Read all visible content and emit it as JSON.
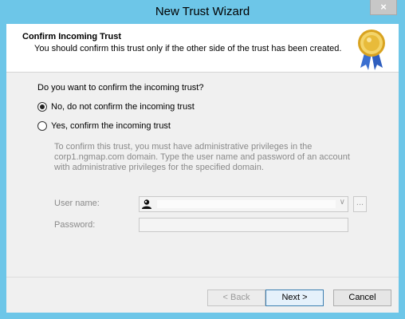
{
  "window": {
    "title": "New Trust Wizard",
    "close_label": "×"
  },
  "header": {
    "title": "Confirm Incoming Trust",
    "subtitle": "You should confirm this trust only if the other side of the trust has been created."
  },
  "question": "Do you want to confirm the incoming trust?",
  "options": [
    {
      "label": "No, do not confirm the incoming trust",
      "selected": true
    },
    {
      "label": "Yes, confirm the incoming trust",
      "selected": false
    }
  ],
  "info_text": "To confirm this trust, you must have administrative privileges in the corp1.ngmap.com domain. Type the user name and password of an account with administrative privileges for the specified domain.",
  "fields": {
    "username_label": "User name:",
    "password_label": "Password:",
    "browse_label": "..."
  },
  "buttons": {
    "back": "< Back",
    "next": "Next >",
    "cancel": "Cancel"
  }
}
